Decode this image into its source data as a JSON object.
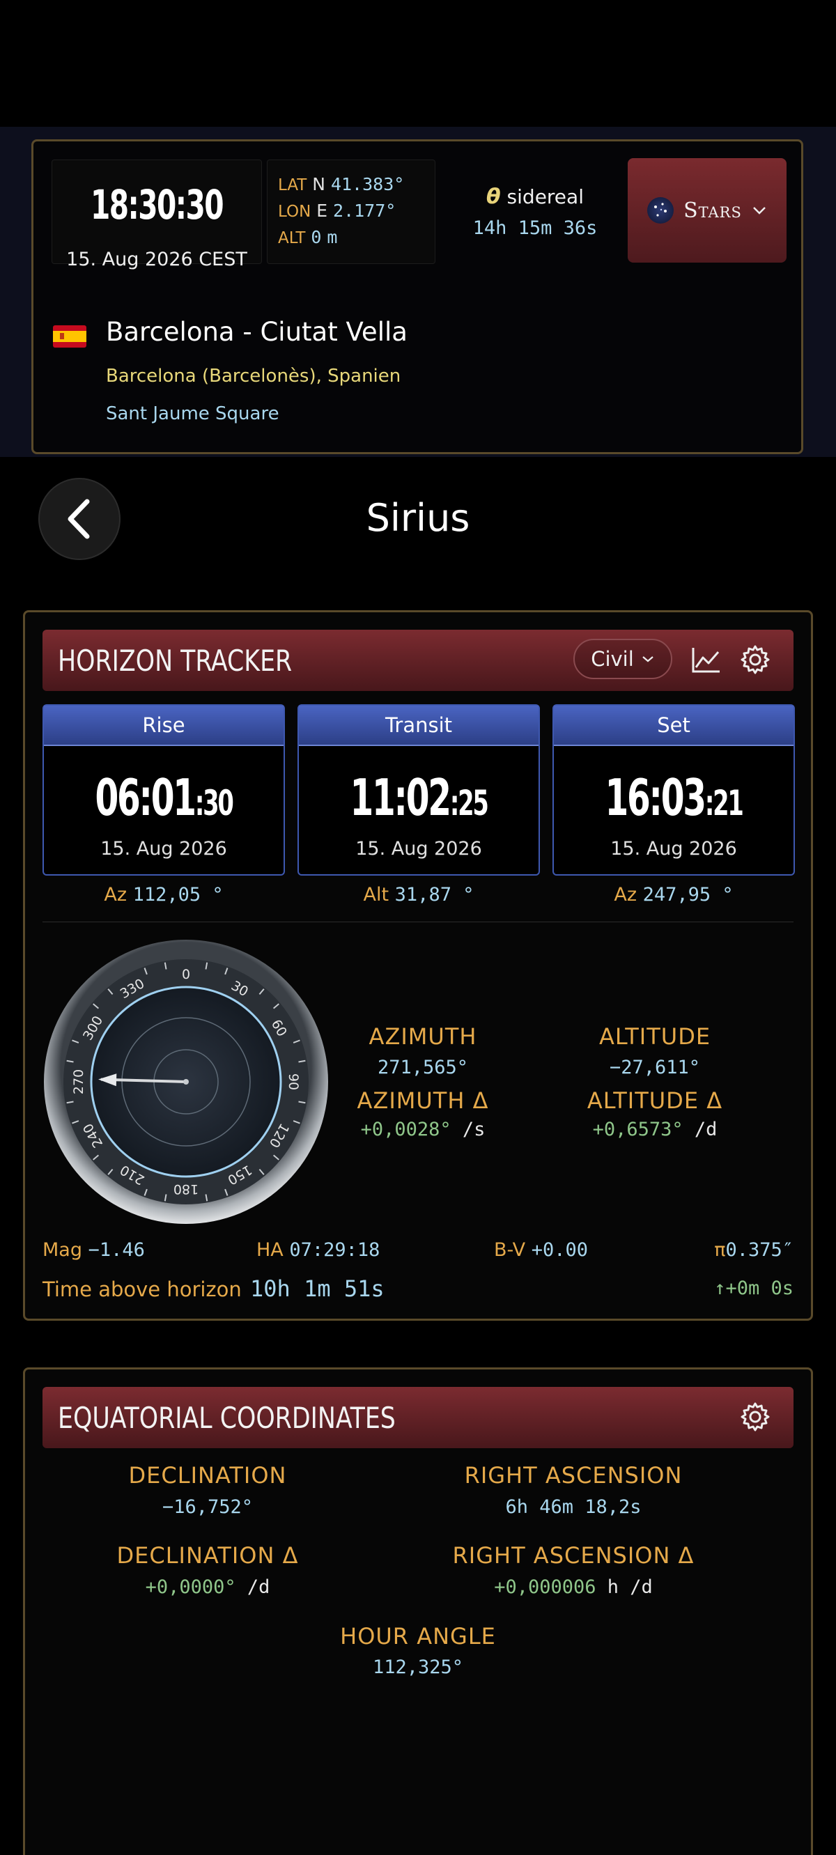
{
  "header": {
    "clock": {
      "time": "18:30:30",
      "date": "15. Aug 2026  CEST"
    },
    "coords": [
      {
        "key": "LAT",
        "dir": "N",
        "value": "41.383°"
      },
      {
        "key": "LON",
        "dir": "E",
        "value": "2.177°"
      },
      {
        "key": "ALT",
        "dir": "0",
        "value": "m"
      }
    ],
    "sidereal": {
      "symbol": "θ",
      "label": "sidereal",
      "value": "14h 15m 36s"
    },
    "mode_button": {
      "label": "Stars",
      "icon": "constellation-icon"
    },
    "location": {
      "flag": "spain-flag-icon",
      "title": "Barcelona - Ciutat Vella",
      "region": "Barcelona (Barcelonès), Spanien",
      "place": "Sant Jaume Square"
    }
  },
  "page": {
    "title": "Sirius",
    "back_icon": "chevron-left-icon"
  },
  "tracker": {
    "title": "HORIZON TRACKER",
    "twilight_select": "Civil",
    "events": [
      {
        "label": "Rise",
        "time_hm": "06:01",
        "time_s": ":30",
        "date": "15. Aug 2026",
        "sub_key": "Az",
        "sub_val": "112,05 °"
      },
      {
        "label": "Transit",
        "time_hm": "11:02",
        "time_s": ":25",
        "date": "15. Aug 2026",
        "sub_key": "Alt",
        "sub_val": "31,87 °"
      },
      {
        "label": "Set",
        "time_hm": "16:03",
        "time_s": ":21",
        "date": "15. Aug 2026",
        "sub_key": "Az",
        "sub_val": "247,95 °"
      }
    ],
    "compass": {
      "ticks": [
        "0",
        "30",
        "60",
        "90",
        "120",
        "150",
        "180",
        "210",
        "240",
        "270",
        "300",
        "330"
      ],
      "azimuth_deg": 271.565
    },
    "metrics": {
      "azimuth_label": "AZIMUTH",
      "azimuth": "271,565°",
      "altitude_label": "ALTITUDE",
      "altitude": "−27,611°",
      "azimuth_delta_label": "AZIMUTH Δ",
      "azimuth_delta": "+0,0028°",
      "azimuth_delta_unit": "/s",
      "altitude_delta_label": "ALTITUDE Δ",
      "altitude_delta": "+0,6573°",
      "altitude_delta_unit": "/d"
    },
    "stats": {
      "mag_key": "Mag",
      "mag": "−1.46",
      "ha_key": "HA",
      "ha": "07:29:18",
      "bv_key": "B-V",
      "bv": "+0.00",
      "pi_key": "π",
      "pi": "0.375″"
    },
    "time_above_horizon": {
      "label": "Time above horizon",
      "value": "10h 1m 51s",
      "delta": "↑+0m 0s"
    }
  },
  "equatorial": {
    "title": "EQUATORIAL COORDINATES",
    "declination_label": "DECLINATION",
    "declination": "−16,752°",
    "ra_label": "RIGHT ASCENSION",
    "ra": "6h 46m 18,2s",
    "declination_delta_label": "DECLINATION Δ",
    "declination_delta": "+0,0000°",
    "declination_delta_unit": "/d",
    "ra_delta_label": "RIGHT ASCENSION Δ",
    "ra_delta": "+0,000006",
    "ra_delta_unit": "h /d",
    "hour_angle_label": "HOUR ANGLE",
    "hour_angle": "112,325°"
  },
  "colors": {
    "accent_gold": "#e5a94a",
    "value_cyan": "#a9d7ee",
    "delta_green": "#8fc68a",
    "header_red": "#7b2b30",
    "event_blue": "#3e58b0"
  }
}
